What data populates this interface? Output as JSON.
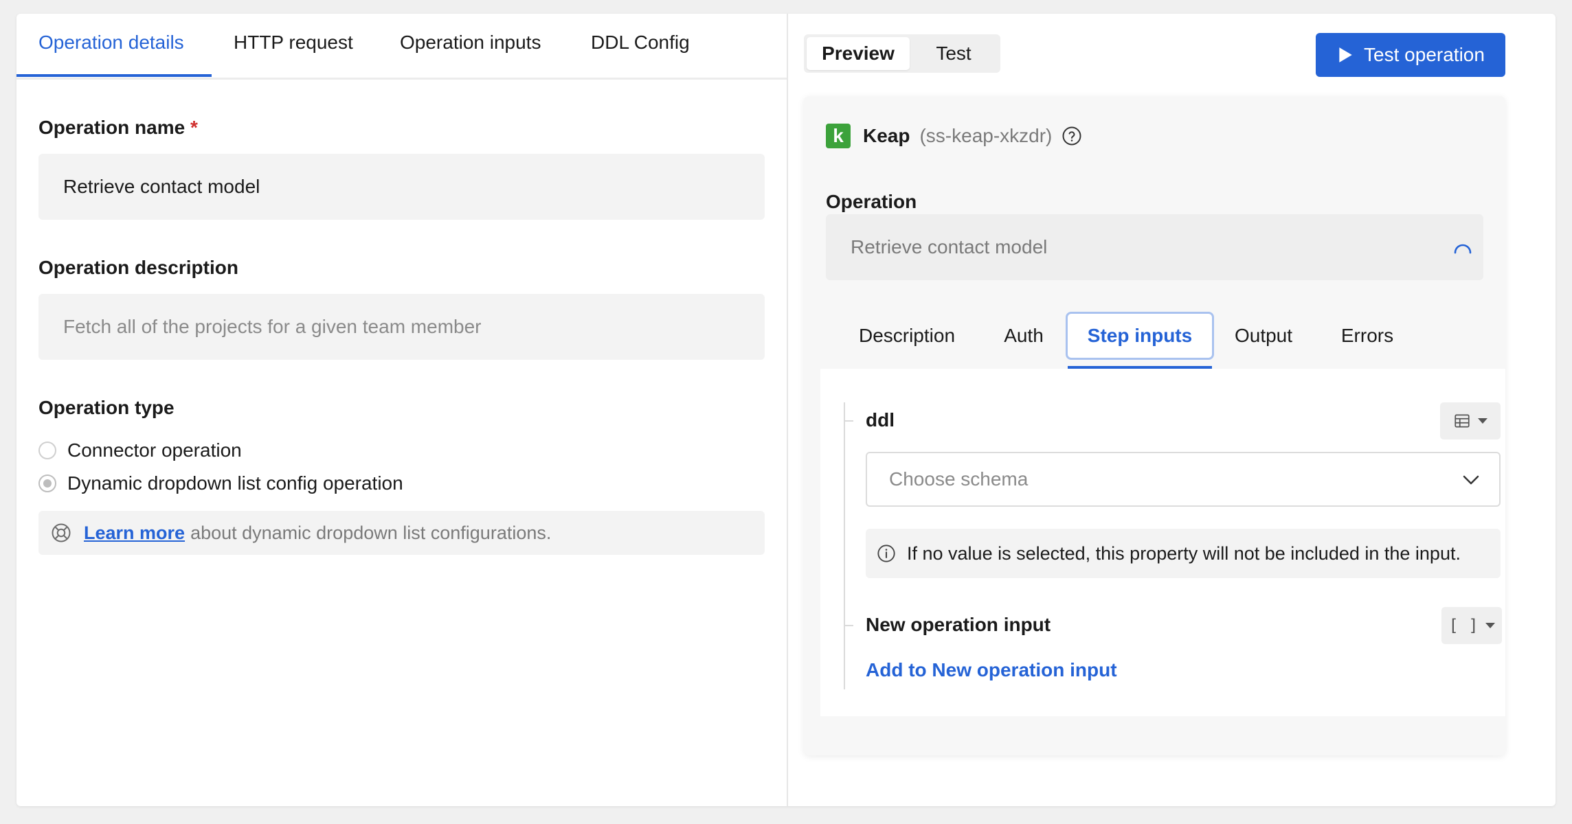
{
  "left": {
    "tabs": [
      {
        "label": "Operation details",
        "active": true
      },
      {
        "label": "HTTP request"
      },
      {
        "label": "Operation inputs"
      },
      {
        "label": "DDL Config"
      }
    ],
    "operation_name": {
      "label": "Operation name",
      "required_mark": "*",
      "value": "Retrieve contact model"
    },
    "operation_description": {
      "label": "Operation description",
      "placeholder": "Fetch all of the projects for a given team member"
    },
    "operation_type": {
      "label": "Operation type",
      "options": [
        {
          "label": "Connector operation",
          "checked": false
        },
        {
          "label": "Dynamic dropdown list config operation",
          "checked": true
        }
      ]
    },
    "hint": {
      "link": "Learn more",
      "text": "about dynamic dropdown list configurations."
    }
  },
  "right": {
    "segmented": {
      "preview": "Preview",
      "test": "Test",
      "active": "Preview"
    },
    "test_button": "Test operation",
    "connector": {
      "logo_letter": "k",
      "name": "Keap",
      "id": "(ss-keap-xkzdr)"
    },
    "operation": {
      "label": "Operation",
      "value": "Retrieve contact model"
    },
    "tabs": [
      {
        "label": "Description"
      },
      {
        "label": "Auth"
      },
      {
        "label": "Step inputs",
        "active": true
      },
      {
        "label": "Output"
      },
      {
        "label": "Errors"
      }
    ],
    "inputs": {
      "ddl": {
        "name": "ddl",
        "select_placeholder": "Choose schema",
        "info": "If no value is selected, this property will not be included in the input."
      },
      "new_input": {
        "name": "New operation input",
        "type_glyph": "[ ]",
        "add_link": "Add to New operation input"
      }
    }
  },
  "colors": {
    "accent": "#2563d6",
    "required": "#d0302f",
    "keap_green": "#3ca23b"
  }
}
